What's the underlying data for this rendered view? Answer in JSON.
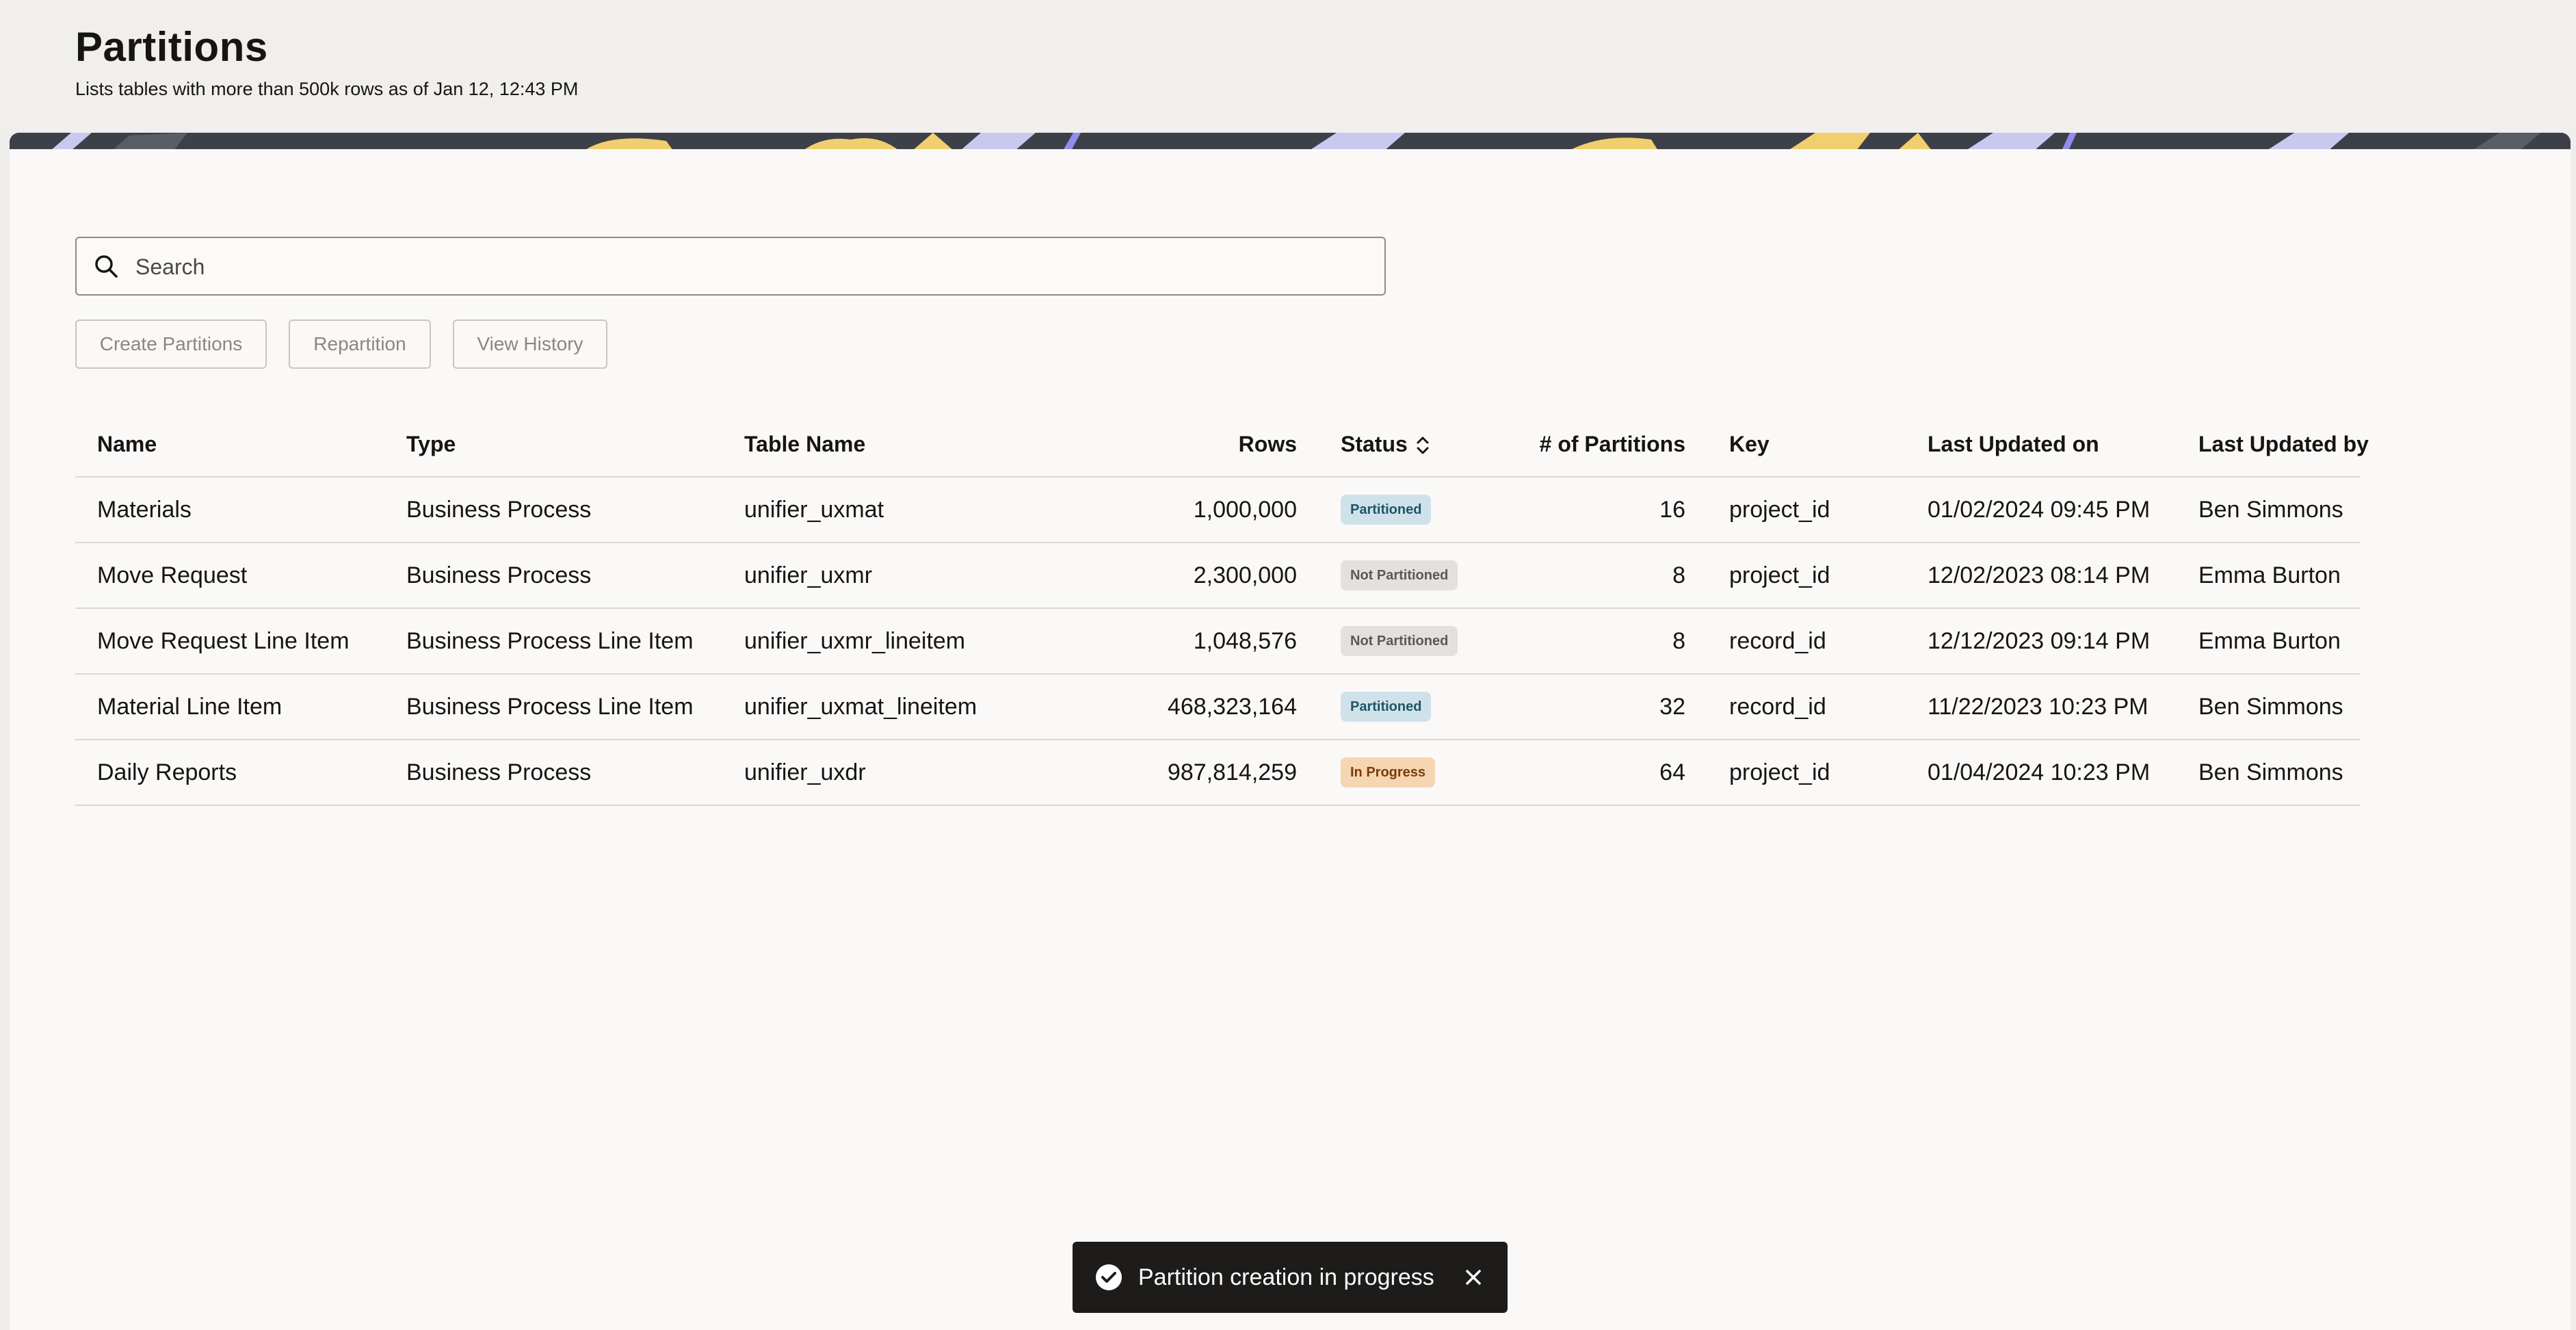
{
  "page": {
    "title": "Partitions",
    "subtitle": "Lists tables with more than 500k rows as of Jan 12, 12:43 PM"
  },
  "search": {
    "placeholder": "Search",
    "value": ""
  },
  "toolbar": {
    "create_label": "Create Partitions",
    "repartition_label": "Repartition",
    "history_label": "View History"
  },
  "table": {
    "columns": {
      "name": "Name",
      "type": "Type",
      "table_name": "Table Name",
      "rows": "Rows",
      "status": "Status",
      "partitions": "# of Partitions",
      "key": "Key",
      "updated_on": "Last Updated on",
      "updated_by": "Last Updated by"
    },
    "rows": [
      {
        "name": "Materials",
        "type": "Business Process",
        "table_name": "unifier_uxmat",
        "rows": "1,000,000",
        "status": "Partitioned",
        "status_kind": "partitioned",
        "partitions": "16",
        "key": "project_id",
        "updated_on": "01/02/2024 09:45 PM",
        "updated_by": "Ben Simmons"
      },
      {
        "name": "Move Request",
        "type": "Business Process",
        "table_name": "unifier_uxmr",
        "rows": "2,300,000",
        "status": "Not Partitioned",
        "status_kind": "not",
        "partitions": "8",
        "key": "project_id",
        "updated_on": "12/02/2023 08:14 PM",
        "updated_by": "Emma Burton"
      },
      {
        "name": "Move Request Line Item",
        "type": "Business Process Line Item",
        "table_name": "unifier_uxmr_lineitem",
        "rows": "1,048,576",
        "status": "Not Partitioned",
        "status_kind": "not",
        "partitions": "8",
        "key": "record_id",
        "updated_on": "12/12/2023 09:14 PM",
        "updated_by": "Emma Burton"
      },
      {
        "name": "Material Line Item",
        "type": "Business Process Line Item",
        "table_name": "unifier_uxmat_lineitem",
        "rows": "468,323,164",
        "status": "Partitioned",
        "status_kind": "partitioned",
        "partitions": "32",
        "key": "record_id",
        "updated_on": "11/22/2023 10:23 PM",
        "updated_by": "Ben Simmons"
      },
      {
        "name": "Daily Reports",
        "type": "Business Process",
        "table_name": "unifier_uxdr",
        "rows": "987,814,259",
        "status": "In Progress",
        "status_kind": "progress",
        "partitions": "64",
        "key": "project_id",
        "updated_on": "01/04/2024 10:23 PM",
        "updated_by": "Ben Simmons"
      }
    ]
  },
  "toast": {
    "message": "Partition creation in progress",
    "icon": "check-circle-icon",
    "close_icon": "close-icon"
  },
  "icons": {
    "search": "search-icon",
    "sort": "sort-icon"
  },
  "colors": {
    "partitioned_bg": "#cfe2ea",
    "not_partitioned_bg": "#e3e1de",
    "in_progress_bg": "#f6d5b2",
    "toast_bg": "#1d1c1a",
    "banner_yellow": "#f2cf6e",
    "banner_lavender": "#c9c9f0"
  }
}
